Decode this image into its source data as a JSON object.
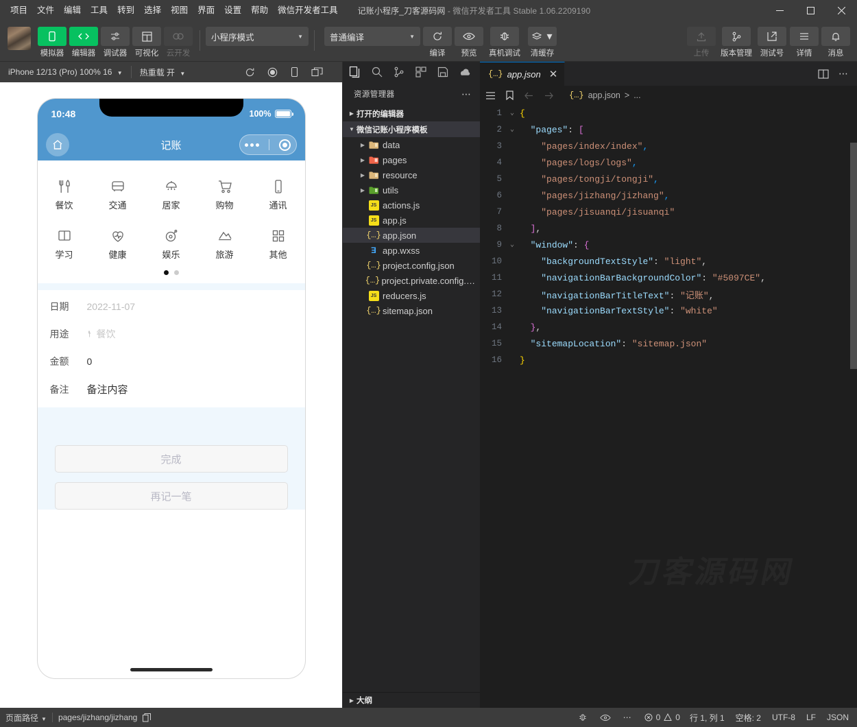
{
  "titlebar": {
    "menus": [
      "项目",
      "文件",
      "编辑",
      "工具",
      "转到",
      "选择",
      "视图",
      "界面",
      "设置",
      "帮助",
      "微信开发者工具"
    ],
    "project_name": "记账小程序_刀客源码网",
    "app_title": " - 微信开发者工具 Stable 1.06.2209190",
    "window_controls": [
      "minimize-icon",
      "maximize-icon",
      "close-icon"
    ]
  },
  "toolbar": {
    "left_buttons": [
      {
        "label": "模拟器",
        "icon": "phone-icon",
        "state": "active"
      },
      {
        "label": "编辑器",
        "icon": "code-icon",
        "state": "active"
      },
      {
        "label": "调试器",
        "icon": "sliders-icon",
        "state": "normal"
      },
      {
        "label": "可视化",
        "icon": "layout-icon",
        "state": "normal"
      },
      {
        "label": "云开发",
        "icon": "cloud-icon",
        "state": "disabled"
      }
    ],
    "mode_select": "小程序模式",
    "compile_select": "普通编译",
    "mid_buttons": [
      {
        "label": "编译",
        "icon": "refresh-icon"
      },
      {
        "label": "预览",
        "icon": "eye-icon"
      },
      {
        "label": "真机调试",
        "icon": "bug-icon"
      },
      {
        "label": "清缓存",
        "icon": "layers-icon"
      }
    ],
    "right_buttons": [
      {
        "label": "上传",
        "icon": "upload-icon",
        "state": "disabled"
      },
      {
        "label": "版本管理",
        "icon": "branch-icon",
        "state": "normal"
      },
      {
        "label": "测试号",
        "icon": "external-link-icon",
        "state": "normal"
      },
      {
        "label": "详情",
        "icon": "menu-icon",
        "state": "normal"
      },
      {
        "label": "消息",
        "icon": "bell-icon",
        "state": "normal"
      }
    ]
  },
  "simulator": {
    "device": "iPhone 12/13 (Pro) 100% 16",
    "hot_reload": "热重载 开",
    "icons": [
      "refresh-icon",
      "record-icon",
      "rotate-icon",
      "multiwindow-icon"
    ],
    "phone": {
      "status_time": "10:48",
      "battery_percent": "100%",
      "nav_title": "记账",
      "home_icon": "home-icon",
      "capsule": [
        "more-dots-icon",
        "target-icon"
      ],
      "categories_row1": [
        {
          "label": "餐饮",
          "icon": "cutlery-icon"
        },
        {
          "label": "交通",
          "icon": "bus-icon"
        },
        {
          "label": "居家",
          "icon": "lamp-icon"
        },
        {
          "label": "购物",
          "icon": "cart-icon"
        },
        {
          "label": "通讯",
          "icon": "mobile-icon"
        }
      ],
      "categories_row2": [
        {
          "label": "学习",
          "icon": "book-icon"
        },
        {
          "label": "健康",
          "icon": "heart-pulse-icon"
        },
        {
          "label": "娱乐",
          "icon": "game-icon"
        },
        {
          "label": "旅游",
          "icon": "mountain-icon"
        },
        {
          "label": "其他",
          "icon": "grid-icon"
        }
      ],
      "pager": {
        "total": 2,
        "current": 1
      },
      "form": [
        {
          "label": "日期",
          "value": "2022-11-07",
          "style": "placeholder"
        },
        {
          "label": "用途",
          "value": "餐饮",
          "style": "placeholder-icon"
        },
        {
          "label": "金额",
          "value": "0",
          "style": "value"
        },
        {
          "label": "备注",
          "value": "备注内容",
          "style": "value"
        }
      ],
      "buttons": [
        "完成",
        "再记一笔"
      ]
    }
  },
  "explorer": {
    "activity_icons": [
      "files-icon",
      "search-icon",
      "source-control-icon",
      "extensions-icon",
      "save-icon",
      "cloud-test-icon"
    ],
    "title": "资源管理器",
    "more_icon": "more-icon",
    "sections": [
      {
        "label": "打开的编辑器",
        "expanded": false
      },
      {
        "label": "微信记账小程序模板",
        "expanded": true
      }
    ],
    "tree": [
      {
        "name": "data",
        "type": "folder",
        "icon": "folder-yellow",
        "expanded": false
      },
      {
        "name": "pages",
        "type": "folder",
        "icon": "folder-red",
        "expanded": false
      },
      {
        "name": "resource",
        "type": "folder",
        "icon": "folder-yellow",
        "expanded": false
      },
      {
        "name": "utils",
        "type": "folder",
        "icon": "folder-green",
        "expanded": false
      },
      {
        "name": "actions.js",
        "type": "file",
        "icon": "js-icon"
      },
      {
        "name": "app.js",
        "type": "file",
        "icon": "js-icon"
      },
      {
        "name": "app.json",
        "type": "file",
        "icon": "json-icon",
        "selected": true
      },
      {
        "name": "app.wxss",
        "type": "file",
        "icon": "wxss-icon"
      },
      {
        "name": "project.config.json",
        "type": "file",
        "icon": "json-icon"
      },
      {
        "name": "project.private.config.js...",
        "type": "file",
        "icon": "json-icon"
      },
      {
        "name": "reducers.js",
        "type": "file",
        "icon": "js-icon"
      },
      {
        "name": "sitemap.json",
        "type": "file",
        "icon": "json-icon"
      }
    ],
    "outline": "大纲"
  },
  "editor": {
    "tab": {
      "name": "app.json",
      "icon": "json-icon",
      "close_icon": "close-icon"
    },
    "toolbar_icons": [
      "split-editor-icon",
      "more-icon"
    ],
    "breadcrumb_icons": [
      "outline-icon",
      "bookmark-icon",
      "back-arrow-icon",
      "forward-arrow-icon"
    ],
    "breadcrumb": {
      "file": "app.json",
      "separator": ">",
      "tail": "..."
    },
    "watermark": "刀客源码网",
    "lines": [
      {
        "n": 1,
        "fold": "v",
        "tokens": [
          {
            "t": "{",
            "c": "br"
          }
        ]
      },
      {
        "n": 2,
        "fold": "v",
        "tokens": [
          {
            "t": "  ",
            "c": "p"
          },
          {
            "t": "\"pages\"",
            "c": "k"
          },
          {
            "t": ": ",
            "c": "p"
          },
          {
            "t": "[",
            "c": "br2"
          }
        ]
      },
      {
        "n": 3,
        "fold": "",
        "tokens": [
          {
            "t": "    ",
            "c": "p"
          },
          {
            "t": "\"pages/index/index\"",
            "c": "s"
          },
          {
            "t": ",",
            "c": "br3"
          }
        ]
      },
      {
        "n": 4,
        "fold": "",
        "tokens": [
          {
            "t": "    ",
            "c": "p"
          },
          {
            "t": "\"pages/logs/logs\"",
            "c": "s"
          },
          {
            "t": ",",
            "c": "br3"
          }
        ]
      },
      {
        "n": 5,
        "fold": "",
        "tokens": [
          {
            "t": "    ",
            "c": "p"
          },
          {
            "t": "\"pages/tongji/tongji\"",
            "c": "s"
          },
          {
            "t": ",",
            "c": "br3"
          }
        ]
      },
      {
        "n": 6,
        "fold": "",
        "tokens": [
          {
            "t": "    ",
            "c": "p"
          },
          {
            "t": "\"pages/jizhang/jizhang\"",
            "c": "s"
          },
          {
            "t": ",",
            "c": "br3"
          }
        ]
      },
      {
        "n": 7,
        "fold": "",
        "tokens": [
          {
            "t": "    ",
            "c": "p"
          },
          {
            "t": "\"pages/jisuanqi/jisuanqi\"",
            "c": "s"
          }
        ]
      },
      {
        "n": 8,
        "fold": "",
        "tokens": [
          {
            "t": "  ",
            "c": "p"
          },
          {
            "t": "]",
            "c": "br2"
          },
          {
            "t": ",",
            "c": "p"
          }
        ]
      },
      {
        "n": 9,
        "fold": "v",
        "tokens": [
          {
            "t": "  ",
            "c": "p"
          },
          {
            "t": "\"window\"",
            "c": "k"
          },
          {
            "t": ": ",
            "c": "p"
          },
          {
            "t": "{",
            "c": "br2"
          }
        ]
      },
      {
        "n": 10,
        "fold": "",
        "tokens": [
          {
            "t": "    ",
            "c": "p"
          },
          {
            "t": "\"backgroundTextStyle\"",
            "c": "k"
          },
          {
            "t": ": ",
            "c": "p"
          },
          {
            "t": "\"light\"",
            "c": "s"
          },
          {
            "t": ",",
            "c": "p"
          }
        ]
      },
      {
        "n": 11,
        "fold": "",
        "tokens": [
          {
            "t": "    ",
            "c": "p"
          },
          {
            "t": "\"navigationBarBackgroundColor\"",
            "c": "k"
          },
          {
            "t": ": ",
            "c": "p"
          },
          {
            "t": "\"#5097CE\"",
            "c": "s"
          },
          {
            "t": ",",
            "c": "p"
          }
        ]
      },
      {
        "n": 12,
        "fold": "",
        "tokens": [
          {
            "t": "    ",
            "c": "p"
          },
          {
            "t": "\"navigationBarTitleText\"",
            "c": "k"
          },
          {
            "t": ": ",
            "c": "p"
          },
          {
            "t": "\"记账\"",
            "c": "s"
          },
          {
            "t": ",",
            "c": "p"
          }
        ]
      },
      {
        "n": 13,
        "fold": "",
        "tokens": [
          {
            "t": "    ",
            "c": "p"
          },
          {
            "t": "\"navigationBarTextStyle\"",
            "c": "k"
          },
          {
            "t": ": ",
            "c": "p"
          },
          {
            "t": "\"white\"",
            "c": "s"
          }
        ]
      },
      {
        "n": 14,
        "fold": "",
        "tokens": [
          {
            "t": "  ",
            "c": "p"
          },
          {
            "t": "}",
            "c": "br2"
          },
          {
            "t": ",",
            "c": "p"
          }
        ]
      },
      {
        "n": 15,
        "fold": "",
        "tokens": [
          {
            "t": "  ",
            "c": "p"
          },
          {
            "t": "\"sitemapLocation\"",
            "c": "k"
          },
          {
            "t": ": ",
            "c": "p"
          },
          {
            "t": "\"sitemap.json\"",
            "c": "s"
          }
        ]
      },
      {
        "n": 16,
        "fold": "",
        "tokens": [
          {
            "t": "}",
            "c": "br"
          }
        ]
      }
    ]
  },
  "statusbar": {
    "page_path_label": "页面路径",
    "page_path_value": "pages/jizhang/jizhang",
    "copy_icon": "copy-icon",
    "mid_icons": [
      "bug-icon",
      "eye-icon",
      "more-icon"
    ],
    "errors": "0",
    "warnings": "0",
    "cursor": "行 1, 列 1",
    "spaces": "空格: 2",
    "encoding": "UTF-8",
    "eol": "LF",
    "language": "JSON"
  },
  "colors": {
    "brand_blue": "#5097CE",
    "wechat_green": "#07c160",
    "bg_dark": "#1e1e1e",
    "panel_dark": "#252526",
    "chrome": "#3c3c3c"
  }
}
